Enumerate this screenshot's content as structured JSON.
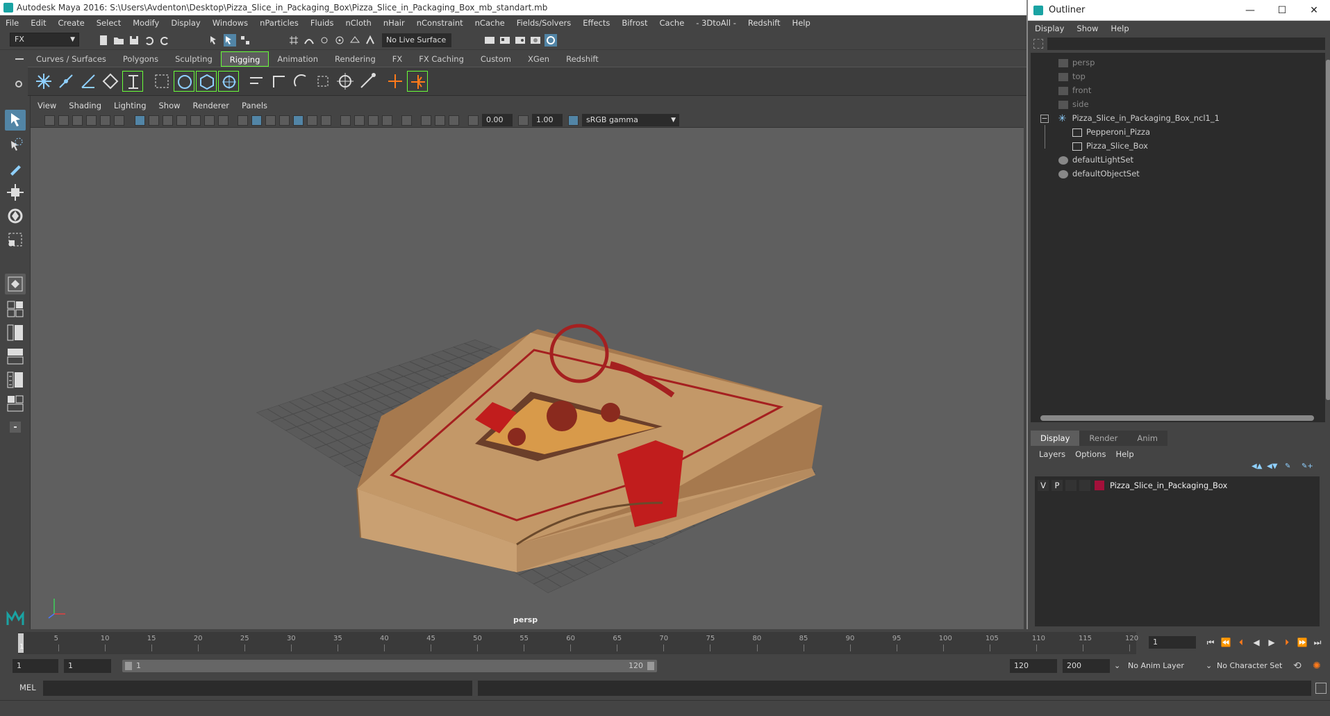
{
  "window": {
    "title": "Autodesk Maya 2016: S:\\Users\\Avdenton\\Desktop\\Pizza_Slice_in_Packaging_Box\\Pizza_Slice_in_Packaging_Box_mb_standart.mb"
  },
  "menubar": [
    "File",
    "Edit",
    "Create",
    "Select",
    "Modify",
    "Display",
    "Windows",
    "nParticles",
    "Fluids",
    "nCloth",
    "nHair",
    "nConstraint",
    "nCache",
    "Fields/Solvers",
    "Effects",
    "Bifrost",
    "Cache",
    "- 3DtoAll -",
    "Redshift",
    "Help"
  ],
  "statusline": {
    "mode": "FX",
    "live_surface": "No Live Surface"
  },
  "shelf": {
    "tabs": [
      "Curves / Surfaces",
      "Polygons",
      "Sculpting",
      "Rigging",
      "Animation",
      "Rendering",
      "FX",
      "FX Caching",
      "Custom",
      "XGen",
      "Redshift"
    ],
    "active_tab": "Rigging"
  },
  "panel": {
    "menu": [
      "View",
      "Shading",
      "Lighting",
      "Show",
      "Renderer",
      "Panels"
    ],
    "exposure": "0.00",
    "gamma": "1.00",
    "color_space": "sRGB gamma",
    "camera_label": "persp"
  },
  "outliner": {
    "title": "Outliner",
    "menu": [
      "Display",
      "Show",
      "Help"
    ],
    "items": [
      {
        "label": "persp",
        "dim": true
      },
      {
        "label": "top",
        "dim": true
      },
      {
        "label": "front",
        "dim": true
      },
      {
        "label": "side",
        "dim": true
      },
      {
        "label": "Pizza_Slice_in_Packaging_Box_ncl1_1",
        "dim": false
      },
      {
        "label": "Pepperoni_Pizza",
        "dim": false
      },
      {
        "label": "Pizza_Slice_Box",
        "dim": false
      },
      {
        "label": "defaultLightSet",
        "dim": false
      },
      {
        "label": "defaultObjectSet",
        "dim": false
      }
    ]
  },
  "layer_editor": {
    "tabs": [
      "Display",
      "Render",
      "Anim"
    ],
    "active_tab": "Display",
    "menu": [
      "Layers",
      "Options",
      "Help"
    ],
    "layer": {
      "v": "V",
      "p": "P",
      "name": "Pizza_Slice_in_Packaging_Box",
      "color": "#a3103a"
    }
  },
  "timeline": {
    "ticks": [
      "5",
      "10",
      "15",
      "20",
      "25",
      "30",
      "35",
      "40",
      "45",
      "50",
      "55",
      "60",
      "65",
      "70",
      "75",
      "80",
      "85",
      "90",
      "95",
      "100",
      "105",
      "110",
      "115",
      "120"
    ],
    "current_marker": "1",
    "current_frame": "1"
  },
  "range": {
    "start": "1",
    "playback_start": "1",
    "bar_start": "1",
    "bar_end": "120",
    "playback_end": "120",
    "end": "200",
    "anim_layer": "No Anim Layer",
    "character_set": "No Character Set"
  },
  "cmdline": {
    "label": "MEL"
  },
  "colors": {
    "accent": "#5285a6",
    "active_outline": "#69ff3a",
    "viewport_bg": "#5f5f5f"
  }
}
